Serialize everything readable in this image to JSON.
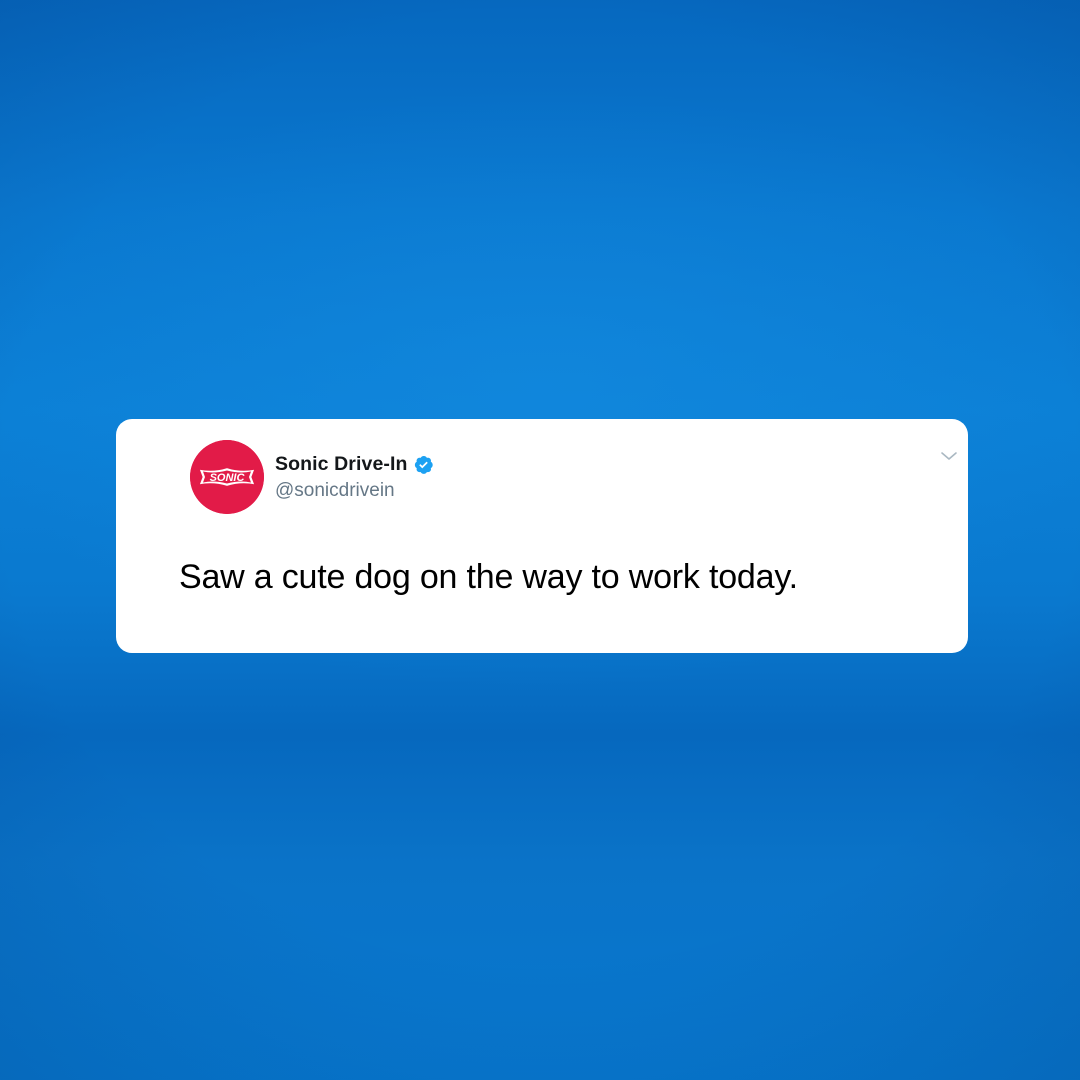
{
  "tweet": {
    "display_name": "Sonic Drive-In",
    "handle": "@sonicdrivein",
    "text": "Saw a cute dog on the way to work today.",
    "verified": true,
    "avatar_logo_text": "SONIC"
  },
  "icons": {
    "avatar": "sonic-logo-icon",
    "verified": "verified-badge-icon",
    "menu": "chevron-down-icon"
  },
  "colors": {
    "background": "#0a78cf",
    "card": "#ffffff",
    "avatar_red": "#e21b48",
    "verified_blue": "#1da1f2",
    "name_text": "#14171a",
    "handle_text": "#657786",
    "body_text": "#000000"
  }
}
